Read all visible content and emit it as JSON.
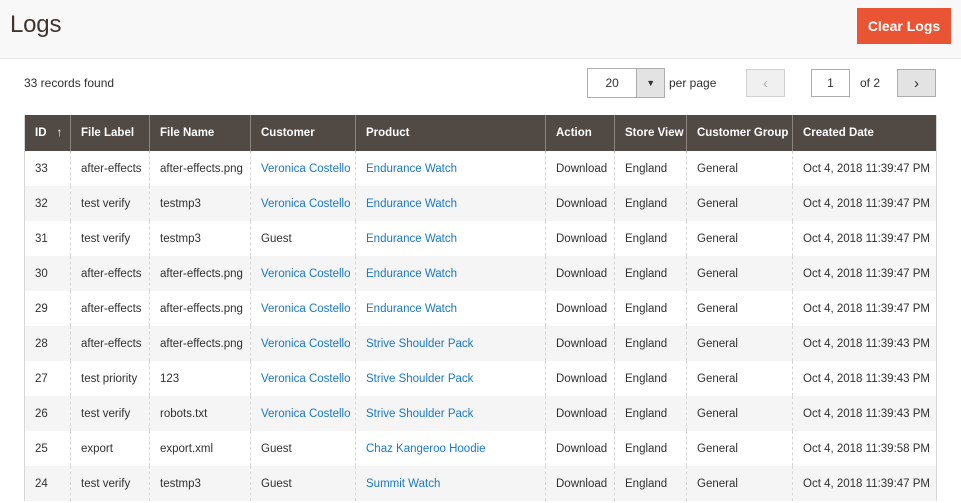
{
  "header": {
    "title": "Logs",
    "clear_button": "Clear Logs"
  },
  "toolbar": {
    "records_found": "33 records found",
    "per_page_value": "20",
    "per_page_label": "per page",
    "current_page": "1",
    "page_of": "of 2",
    "prev_icon": "‹",
    "next_icon": "›",
    "dropdown_icon": "▼"
  },
  "colors": {
    "accent_button": "#e85434",
    "header_bg": "#514943",
    "link": "#1979c3"
  },
  "table": {
    "sort_icon": "↑",
    "columns": [
      "ID",
      "File Label",
      "File Name",
      "Customer",
      "Product",
      "Action",
      "Store View",
      "Customer Group",
      "Created Date"
    ],
    "rows": [
      {
        "id": "33",
        "file_label": "after-effects",
        "file_name": "after-effects.png",
        "customer": "Veronica Costello",
        "customer_link": true,
        "product": "Endurance Watch",
        "action": "Download",
        "store_view": "England",
        "customer_group": "General",
        "created": "Oct 4, 2018 11:39:47 PM"
      },
      {
        "id": "32",
        "file_label": "test verify",
        "file_name": "testmp3",
        "customer": "Veronica Costello",
        "customer_link": true,
        "product": "Endurance Watch",
        "action": "Download",
        "store_view": "England",
        "customer_group": "General",
        "created": "Oct 4, 2018 11:39:47 PM"
      },
      {
        "id": "31",
        "file_label": "test verify",
        "file_name": "testmp3",
        "customer": "Guest",
        "customer_link": false,
        "product": "Endurance Watch",
        "action": "Download",
        "store_view": "England",
        "customer_group": "General",
        "created": "Oct 4, 2018 11:39:47 PM"
      },
      {
        "id": "30",
        "file_label": "after-effects",
        "file_name": "after-effects.png",
        "customer": "Veronica Costello",
        "customer_link": true,
        "product": "Endurance Watch",
        "action": "Download",
        "store_view": "England",
        "customer_group": "General",
        "created": "Oct 4, 2018 11:39:47 PM"
      },
      {
        "id": "29",
        "file_label": "after-effects",
        "file_name": "after-effects.png",
        "customer": "Veronica Costello",
        "customer_link": true,
        "product": "Endurance Watch",
        "action": "Download",
        "store_view": "England",
        "customer_group": "General",
        "created": "Oct 4, 2018 11:39:47 PM"
      },
      {
        "id": "28",
        "file_label": "after-effects",
        "file_name": "after-effects.png",
        "customer": "Veronica Costello",
        "customer_link": true,
        "product": "Strive Shoulder Pack",
        "action": "Download",
        "store_view": "England",
        "customer_group": "General",
        "created": "Oct 4, 2018 11:39:43 PM"
      },
      {
        "id": "27",
        "file_label": "test priority",
        "file_name": "123",
        "customer": "Veronica Costello",
        "customer_link": true,
        "product": "Strive Shoulder Pack",
        "action": "Download",
        "store_view": "England",
        "customer_group": "General",
        "created": "Oct 4, 2018 11:39:43 PM"
      },
      {
        "id": "26",
        "file_label": "test verify",
        "file_name": "robots.txt",
        "customer": "Veronica Costello",
        "customer_link": true,
        "product": "Strive Shoulder Pack",
        "action": "Download",
        "store_view": "England",
        "customer_group": "General",
        "created": "Oct 4, 2018 11:39:43 PM"
      },
      {
        "id": "25",
        "file_label": "export",
        "file_name": "export.xml",
        "customer": "Guest",
        "customer_link": false,
        "product": "Chaz Kangeroo Hoodie",
        "action": "Download",
        "store_view": "England",
        "customer_group": "General",
        "created": "Oct 4, 2018 11:39:58 PM"
      },
      {
        "id": "24",
        "file_label": "test verify",
        "file_name": "testmp3",
        "customer": "Guest",
        "customer_link": false,
        "product": "Summit Watch",
        "action": "Download",
        "store_view": "England",
        "customer_group": "General",
        "created": "Oct 4, 2018 11:39:47 PM"
      }
    ]
  }
}
